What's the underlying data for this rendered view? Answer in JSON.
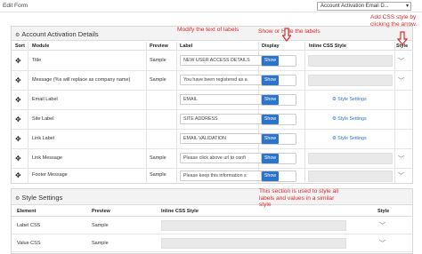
{
  "header": {
    "title": "Edit Form",
    "select_value": "Account Activation Email D..."
  },
  "panel1": {
    "title": "Account Activation Details",
    "columns": [
      "Sort",
      "Module",
      "Preview",
      "Label",
      "Display",
      "Inline CSS Style",
      "Style"
    ],
    "rows": [
      {
        "module": "Title",
        "preview": "Sample",
        "label": "NEW USER ACCESS DETAILS",
        "display": "Show",
        "style_link": ""
      },
      {
        "module": "Message (%s will replace as company name)",
        "preview": "Sample",
        "label": "You have been registered as a",
        "display": "Show",
        "style_link": ""
      },
      {
        "module": "Email Label",
        "preview": "",
        "label": "EMAIL",
        "display": "Show",
        "style_link": "Style Settings"
      },
      {
        "module": "Site Label",
        "preview": "",
        "label": "SITE ADDRESS",
        "display": "Show",
        "style_link": "Style Settings"
      },
      {
        "module": "Link Label",
        "preview": "",
        "label": "EMAIL VALIDATION",
        "display": "Show",
        "style_link": "Style Settings"
      },
      {
        "module": "Link Message",
        "preview": "Sample",
        "label": "Please click above url to confi",
        "display": "Show",
        "style_link": ""
      },
      {
        "module": "Footer Message",
        "preview": "Sample",
        "label": "Please keep this information s",
        "display": "Show",
        "style_link": ""
      }
    ]
  },
  "panel2": {
    "title": "Style Settings",
    "columns": [
      "Element",
      "Preview",
      "Inline CSS Style",
      "Style"
    ],
    "rows": [
      {
        "element": "Label CSS",
        "preview": "Sample"
      },
      {
        "element": "Value CSS",
        "preview": "Sample"
      }
    ]
  },
  "annotations": {
    "modify_labels": "Modify the text of labels",
    "show_hide": "Show or Hide the labels",
    "add_css": "Add CSS style by clicking the arrow.",
    "section_note": "This section is used to style all labels and values in a similar style"
  },
  "colors": {
    "accent": "#2b74c8",
    "annotation": "#e0282a"
  },
  "icons": {
    "drag": "✥",
    "chevron": "﹀",
    "gear": "⚙"
  }
}
